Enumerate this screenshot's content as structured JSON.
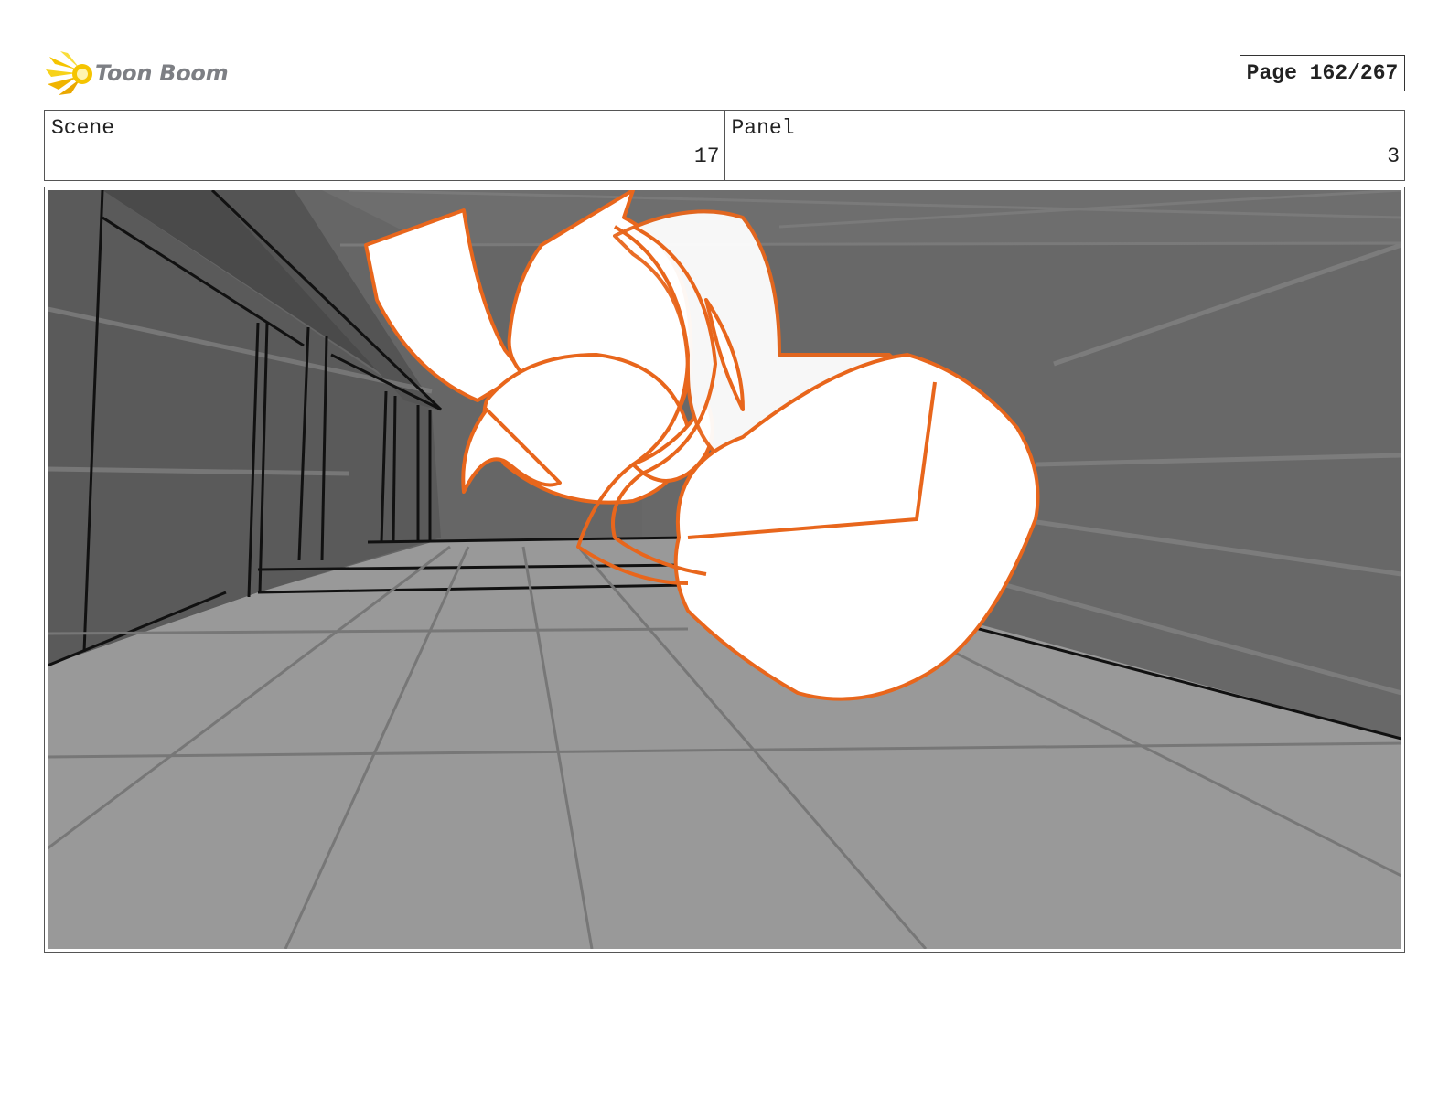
{
  "logo": {
    "brand_text": "Toon Boom",
    "icon": "starburst-icon",
    "accent_color": "#f5c400"
  },
  "page": {
    "label": "Page 162/267"
  },
  "info": {
    "scene_label": "Scene",
    "scene_value": "17",
    "panel_label": "Panel",
    "panel_value": "3"
  },
  "artwork": {
    "stroke_color": "#e8661c",
    "fill_color": "#ffffff"
  }
}
